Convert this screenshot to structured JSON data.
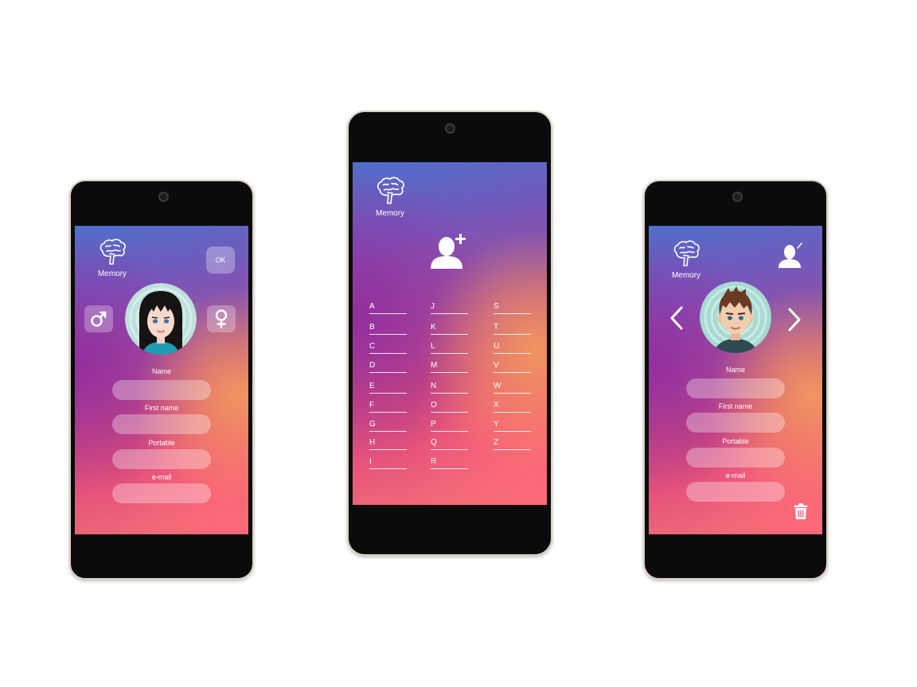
{
  "screens": {
    "create": {
      "logo_label": "Memory",
      "ok_label": "OK",
      "male_symbol": "♂",
      "female_symbol": "♀",
      "fields": [
        {
          "label": "Name",
          "value": ""
        },
        {
          "label": "First name",
          "value": ""
        },
        {
          "label": "Portable",
          "value": ""
        },
        {
          "label": "e-mail",
          "value": ""
        }
      ]
    },
    "contacts": {
      "logo_label": "Memory",
      "add_icon": "add-contact-icon",
      "columns": [
        [
          "A",
          "B",
          "C",
          "D",
          "E",
          "F",
          "G",
          "H",
          "I"
        ],
        [
          "J",
          "K",
          "L",
          "M",
          "N",
          "O",
          "P",
          "Q",
          "R"
        ],
        [
          "S",
          "T",
          "U",
          "V",
          "W",
          "X",
          "Y",
          "Z"
        ]
      ]
    },
    "edit": {
      "logo_label": "Memory",
      "edit_icon": "edit-contact-icon",
      "fields": [
        {
          "label": "Name",
          "value": ""
        },
        {
          "label": "First name",
          "value": ""
        },
        {
          "label": "Portable",
          "value": ""
        },
        {
          "label": "e-mail",
          "value": ""
        }
      ],
      "delete_icon": "trash-icon"
    }
  },
  "colors": {
    "bezel": "#0b0b0b",
    "frame": "#d9d2c2",
    "gradient_top": "#4f6ecb",
    "gradient_mid": "#c9487f",
    "gradient_bottom": "#f0727a",
    "accent_orange": "#f5a05a"
  }
}
